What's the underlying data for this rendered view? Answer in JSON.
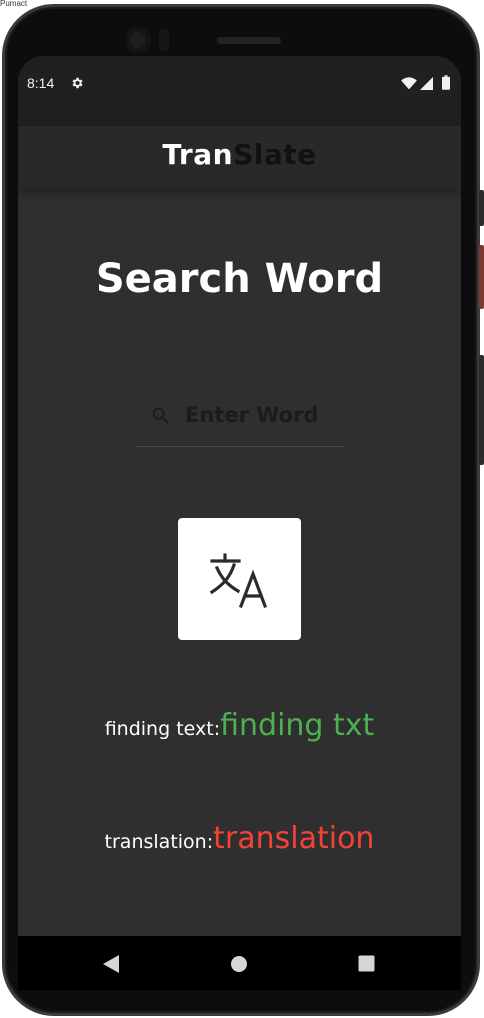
{
  "emulator": {
    "window_label": "Pumact"
  },
  "status_bar": {
    "time": "8:14",
    "icons": [
      "gear-icon",
      "wifi-icon",
      "signal-icon",
      "battery-icon"
    ]
  },
  "app_bar": {
    "title_part1": "Tran",
    "title_part2": "Slate"
  },
  "main": {
    "title": "Search Word",
    "search": {
      "placeholder": "Enter Word",
      "value": "",
      "icon": "search-icon"
    },
    "translate_button": {
      "icon": "translate-icon"
    },
    "finding": {
      "label": "finding text:",
      "value": "finding txt"
    },
    "translation": {
      "label": "translation:",
      "value": "translation"
    }
  },
  "nav_bar": {
    "icons": [
      "back-icon",
      "home-icon",
      "recents-icon"
    ]
  },
  "colors": {
    "screen_bg": "#2f2f2f",
    "app_bar_bg": "#292929",
    "status_bar_bg": "#202020",
    "finding_value": "#4caf50",
    "translation_value": "#f44336"
  }
}
